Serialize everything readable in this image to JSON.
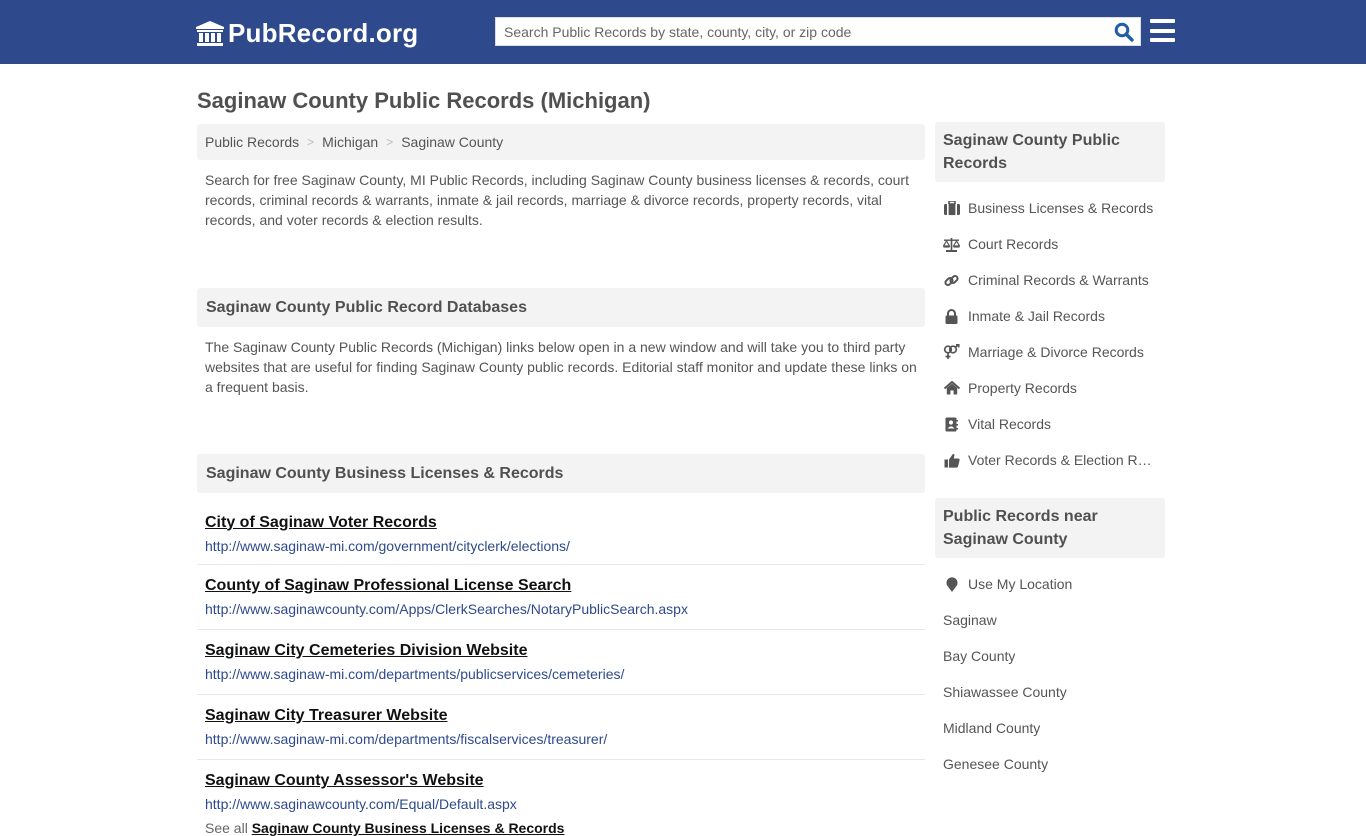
{
  "header": {
    "logo_text": "PubRecord.org",
    "search_placeholder": "Search Public Records by state, county, city, or zip code",
    "colors": {
      "brand": "#2e4a8c",
      "search_icon": "#1f5fa8"
    }
  },
  "page": {
    "title": "Saginaw County Public Records (Michigan)",
    "breadcrumb": [
      {
        "label": "Public Records"
      },
      {
        "label": "Michigan"
      },
      {
        "label": "Saginaw County"
      }
    ],
    "breadcrumb_separator": ">",
    "intro": "Search for free Saginaw County, MI Public Records, including Saginaw County business licenses & records, court records, criminal records & warrants, inmate & jail records, marriage & divorce records, property records, vital records, and voter records & election results."
  },
  "databases": {
    "heading": "Saginaw County Public Record Databases",
    "description": "The Saginaw County Public Records (Michigan) links below open in a new window and will take you to third party websites that are useful for finding Saginaw County public records. Editorial staff monitor and update these links on a frequent basis."
  },
  "business": {
    "heading": "Saginaw County Business Licenses & Records",
    "links": [
      {
        "title": "City of Saginaw Voter Records",
        "url": "http://www.saginaw-mi.com/government/cityclerk/elections/"
      },
      {
        "title": "County of Saginaw Professional License Search",
        "url": "http://www.saginawcounty.com/Apps/ClerkSearches/NotaryPublicSearch.aspx"
      },
      {
        "title": "Saginaw City Cemeteries Division Website",
        "url": "http://www.saginaw-mi.com/departments/publicservices/cemeteries/"
      },
      {
        "title": "Saginaw City Treasurer Website",
        "url": "http://www.saginaw-mi.com/departments/fiscalservices/treasurer/"
      },
      {
        "title": "Saginaw County Assessor's Website",
        "url": "http://www.saginawcounty.com/Equal/Default.aspx"
      }
    ],
    "see_all_prefix": "See all",
    "see_all_link": "Saginaw County Business Licenses & Records"
  },
  "sidebar": {
    "records_heading": "Saginaw County Public Records",
    "records": [
      {
        "label": "Business Licenses & Records",
        "icon": "briefcase-icon"
      },
      {
        "label": "Court Records",
        "icon": "balance-scale-icon"
      },
      {
        "label": "Criminal Records & Warrants",
        "icon": "link-icon"
      },
      {
        "label": "Inmate & Jail Records",
        "icon": "lock-icon"
      },
      {
        "label": "Marriage & Divorce Records",
        "icon": "venus-mars-icon"
      },
      {
        "label": "Property Records",
        "icon": "home-icon"
      },
      {
        "label": "Vital Records",
        "icon": "address-book-icon"
      },
      {
        "label": "Voter Records & Election Results",
        "icon": "thumbs-up-icon"
      }
    ],
    "near_heading": "Public Records near Saginaw County",
    "use_location": "Use My Location",
    "near": [
      {
        "label": "Saginaw"
      },
      {
        "label": "Bay County"
      },
      {
        "label": "Shiawassee County"
      },
      {
        "label": "Midland County"
      },
      {
        "label": "Genesee County"
      }
    ]
  }
}
